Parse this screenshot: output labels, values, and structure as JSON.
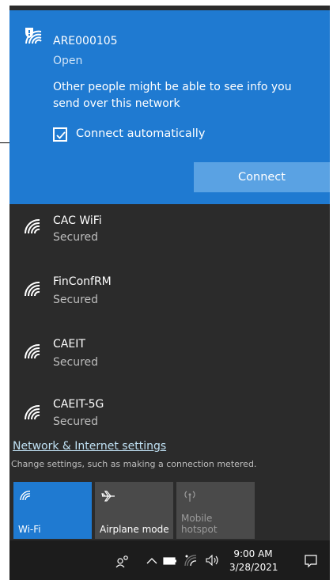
{
  "active_network": {
    "name": "ARE000105",
    "status": "Open",
    "warning": "Other people might be able to see info you send over this network",
    "auto_connect_label": "Connect automatically",
    "auto_connect_checked": true,
    "connect_label": "Connect",
    "icon": "wifi-open-shield-icon"
  },
  "networks": [
    {
      "name": "CAC WiFi",
      "status": "Secured",
      "icon": "wifi-icon"
    },
    {
      "name": "FinConfRM",
      "status": "Secured",
      "icon": "wifi-icon"
    },
    {
      "name": "CAEIT",
      "status": "Secured",
      "icon": "wifi-icon"
    },
    {
      "name": "CAEIT-5G",
      "status": "Secured",
      "icon": "wifi-icon"
    }
  ],
  "settings": {
    "link": "Network & Internet settings",
    "subtitle": "Change settings, such as making a connection metered."
  },
  "quick_actions": {
    "wifi": "Wi-Fi",
    "airplane": "Airplane mode",
    "hotspot_line1": "Mobile",
    "hotspot_line2": "hotspot"
  },
  "taskbar": {
    "time": "9:00 AM",
    "date": "3/28/2021"
  },
  "colors": {
    "accent": "#1f7ad1",
    "panel": "#2b2b2b",
    "taskbar": "#1c1c1c"
  }
}
